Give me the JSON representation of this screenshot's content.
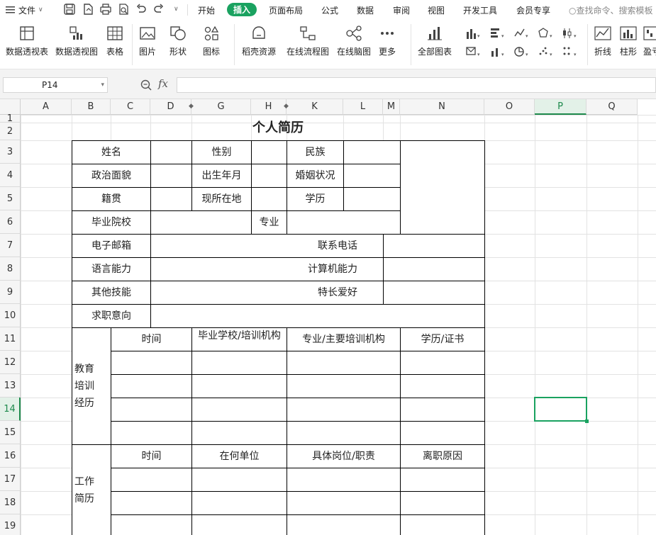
{
  "menu": {
    "file_label": "文件",
    "tabs": [
      "开始",
      "插入",
      "页面布局",
      "公式",
      "数据",
      "审阅",
      "视图",
      "开发工具",
      "会员专享"
    ],
    "active_tab": "插入",
    "search_placeholder": "查找命令、搜索模板"
  },
  "ribbon": {
    "buttons": [
      "数据透视表",
      "数据透视图",
      "表格",
      "图片",
      "形状",
      "图标",
      "稻壳资源",
      "在线流程图",
      "在线脑图",
      "更多",
      "全部图表",
      "折线",
      "柱形",
      "盈亏"
    ]
  },
  "formula_bar": {
    "cell_ref": "P14",
    "fx_label": "fx",
    "formula": ""
  },
  "grid": {
    "columns": [
      "A",
      "B",
      "C",
      "D",
      "G",
      "H",
      "K",
      "L",
      "M",
      "N",
      "O",
      "P",
      "Q"
    ],
    "rows": [
      "1",
      "2",
      "3",
      "4",
      "5",
      "6",
      "7",
      "8",
      "9",
      "10",
      "11",
      "12",
      "13",
      "14",
      "15",
      "16",
      "17",
      "18",
      "19"
    ],
    "selected_cell": "P14"
  },
  "resume": {
    "title": "个人简历",
    "name": "姓名",
    "gender": "性别",
    "ethnicity": "民族",
    "political_status": "政治面貌",
    "birth_date": "出生年月",
    "marital_status": "婚姻状况",
    "native_place": "籍贯",
    "current_location": "现所在地",
    "education": "学历",
    "graduated_school": "毕业院校",
    "major": "专业",
    "email": "电子邮箱",
    "phone": "联系电话",
    "language": "语言能力",
    "computer": "计算机能力",
    "other_skills": "其他技能",
    "hobbies": "特长爱好",
    "job_intention": "求职意向",
    "edu_section": "教育\n培训\n经历",
    "edu_headers": [
      "时间",
      "毕业学校/培训机构",
      "专业/主要培训机构",
      "学历/证书"
    ],
    "work_section": "工作\n简历",
    "work_headers": [
      "时间",
      "在何单位",
      "具体岗位/职责",
      "离职原因"
    ]
  }
}
